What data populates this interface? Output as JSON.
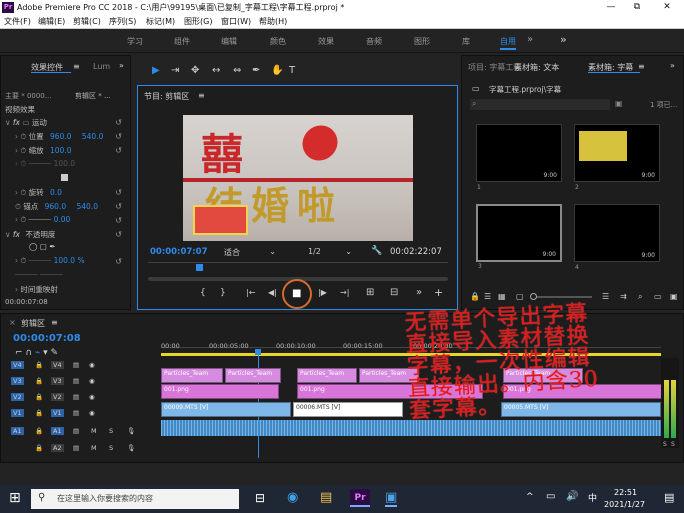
{
  "titlebar": {
    "logo": "Pr",
    "title": "Adobe Premiere Pro CC 2018 - C:\\用户\\99195\\桌面\\已复制_字幕工程\\字幕工程.prproj *",
    "min": "—",
    "max": "⧉",
    "close": "✕"
  },
  "menu": [
    "文件(F)",
    "编辑(E)",
    "剪辑(C)",
    "序列(S)",
    "标记(M)",
    "图形(G)",
    "窗口(W)",
    "帮助(H)"
  ],
  "workspaces": [
    "学习",
    "组件",
    "编辑",
    "颜色",
    "效果",
    "音频",
    "图形",
    "库",
    "自用"
  ],
  "workspace_active": "自用",
  "workspace_more": "»",
  "effect_controls": {
    "tab1": "效果控件",
    "tab1_menu": "≡",
    "tab2": "Lum",
    "more": "»",
    "source": "主要 * 0000...",
    "clip": "剪辑区 * ...",
    "section": "视频效果",
    "motion": "运动",
    "position_label": "位置",
    "position_x": "960.0",
    "position_y": "540.0",
    "scale_label": "缩放",
    "scale_val": "100.0",
    "rotation_label": "旋转",
    "rotation_val": "0.0",
    "anchor_label": "锚点",
    "anchor_x": "960.0",
    "anchor_y": "540.0",
    "anti_flicker_val": "0.00",
    "opacity_label": "不透明度",
    "opacity_val": "100.0 %",
    "time_remap": "时间重映射",
    "timecode": "00:00:07:08",
    "fx": "fx"
  },
  "program_monitor": {
    "title": "节目: 剪辑区",
    "title_menu": "≡",
    "current_time": "00:00:07:07",
    "fit": "适合",
    "ratio": "1/2",
    "duration": "00:02:22:07",
    "video_text_1": "囍",
    "video_text_2": "结婚啦"
  },
  "tools": [
    "▶",
    "⇥",
    "✥",
    "↔",
    "✂",
    "⇔",
    "✒",
    "✋",
    "T"
  ],
  "transport": [
    "{",
    "}",
    "|←",
    "◀|",
    "■",
    "|▶",
    "→|",
    "⊞",
    "⊟",
    "+"
  ],
  "project": {
    "tab1": "项目: 字幕工程",
    "tab2": "素材箱: 文本",
    "tab3": "素材箱: 字幕",
    "path": "字幕工程.prproj\\字幕",
    "count": "1 项已...",
    "menu": "≡",
    "more": "»",
    "items": [
      {
        "num": "1",
        "dur": "9:00"
      },
      {
        "num": "2",
        "dur": "9:00"
      },
      {
        "num": "3",
        "dur": "9:00"
      },
      {
        "num": "4",
        "dur": "9:00"
      }
    ]
  },
  "timeline": {
    "tab": "剪辑区",
    "tab_menu": "≡",
    "close": "×",
    "timecode": "00:00:07:08",
    "ruler": [
      "00:00",
      "00:00:05:00",
      "00:00:10:00",
      "00:00:15:00",
      "00:00:20:00"
    ],
    "tracks": [
      {
        "name": "V4",
        "sel": "V4",
        "lock": "🔒"
      },
      {
        "name": "V3",
        "sel": "V3",
        "lock": "🔒"
      },
      {
        "name": "V2",
        "sel": "V2",
        "lock": "🔒"
      },
      {
        "name": "V1",
        "sel": "V1",
        "lock": "🔒"
      },
      {
        "name": "A1",
        "sel": "A1",
        "lock": "🔒"
      },
      {
        "name": "A2",
        "sel": "A2",
        "lock": "🔒"
      }
    ],
    "track_m": "M",
    "track_s": "S",
    "clips_v3": [
      "Particles_Team",
      "Particles_Team",
      "Particles_Team",
      "Particles_Team",
      "Particles_Team"
    ],
    "clips_v2": [
      "001.png",
      "001.png",
      "001.png"
    ],
    "clips_v1": [
      "00009.MTS [V]",
      "00006.MTS [V]",
      "00005.MTS [V]"
    ],
    "audio_s": "S"
  },
  "overlay": {
    "text": "无需单个导出字幕\n直接导入素材替换\n字幕，一次性编辑\n直接输出。内含30\n套字幕。"
  },
  "taskbar": {
    "start": "⊞",
    "search_placeholder": "在这里输入你要搜索的内容",
    "apps": [
      "⊟",
      "◉",
      "▤",
      "Pr",
      "▣"
    ],
    "time": "22:51",
    "date": "2021/1/27",
    "lang": "中",
    "tray": "^"
  },
  "colors": {
    "accent": "#2d8ceb",
    "clip_v3": "#d68ae0",
    "clip_v2": "#d975d9",
    "clip_v1": "#7fb7e8",
    "audio": "#3e89c8",
    "overlay_red": "#e01a1a"
  }
}
